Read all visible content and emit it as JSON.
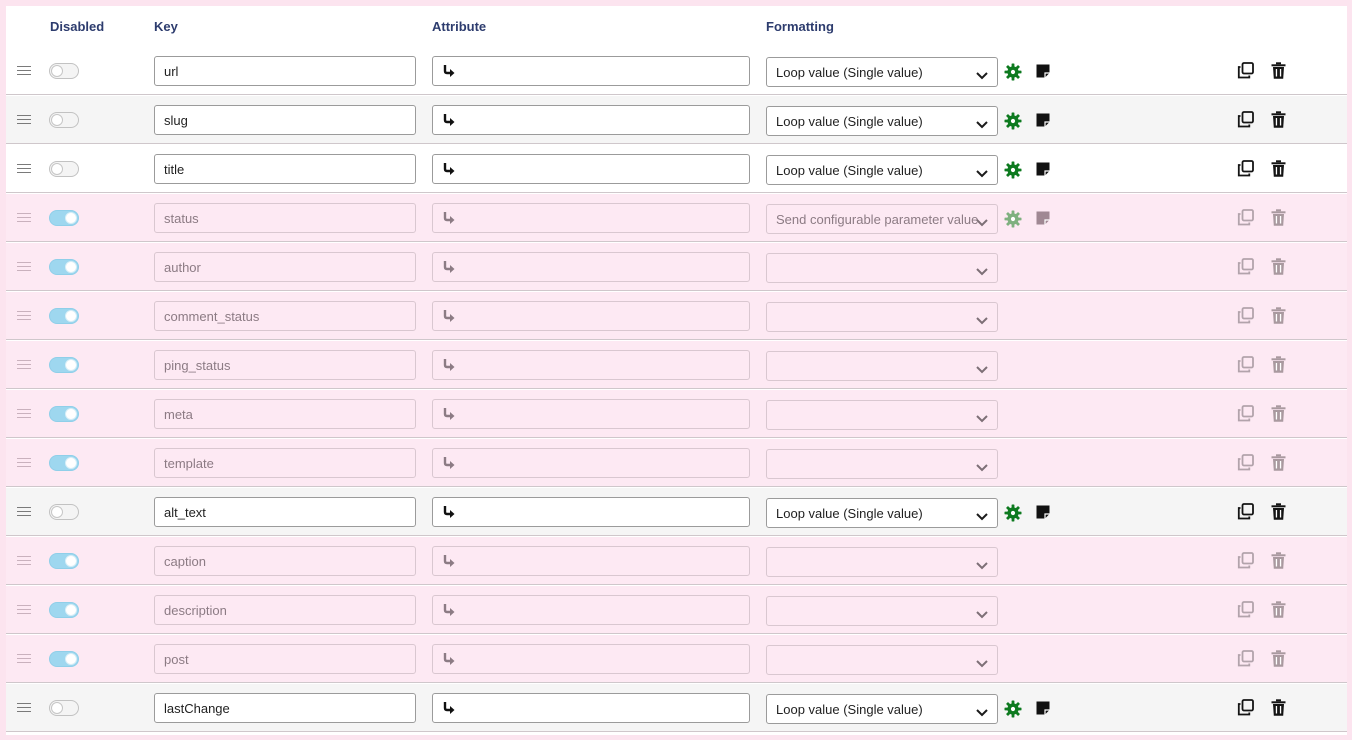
{
  "header": {
    "disabled": "Disabled",
    "key": "Key",
    "attribute": "Attribute",
    "formatting": "Formatting"
  },
  "icons": {
    "drag": "drag-handle-icon",
    "attribute": "return-arrow-icon",
    "dropdown": "chevron-down-icon",
    "settings": "gear-icon",
    "note": "note-icon",
    "copy": "copy-icon",
    "delete": "trash-icon"
  },
  "colors": {
    "gear_green": "#0d7a1f",
    "toggle_on": "#9ed7ef",
    "disabled_row_bg": "#fde9f3"
  },
  "rows": [
    {
      "key": "url",
      "formatting": "Loop value (Single value)",
      "disabled": false,
      "show_tools": true
    },
    {
      "key": "slug",
      "formatting": "Loop value (Single value)",
      "disabled": false,
      "show_tools": true
    },
    {
      "key": "title",
      "formatting": "Loop value (Single value)",
      "disabled": false,
      "show_tools": true
    },
    {
      "key": "status",
      "formatting": "Send configurable parameter value",
      "disabled": true,
      "show_tools": true
    },
    {
      "key": "author",
      "formatting": "",
      "disabled": true,
      "show_tools": false
    },
    {
      "key": "comment_status",
      "formatting": "",
      "disabled": true,
      "show_tools": false
    },
    {
      "key": "ping_status",
      "formatting": "",
      "disabled": true,
      "show_tools": false
    },
    {
      "key": "meta",
      "formatting": "",
      "disabled": true,
      "show_tools": false
    },
    {
      "key": "template",
      "formatting": "",
      "disabled": true,
      "show_tools": false
    },
    {
      "key": "alt_text",
      "formatting": "Loop value (Single value)",
      "disabled": false,
      "show_tools": true
    },
    {
      "key": "caption",
      "formatting": "",
      "disabled": true,
      "show_tools": false
    },
    {
      "key": "description",
      "formatting": "",
      "disabled": true,
      "show_tools": false
    },
    {
      "key": "post",
      "formatting": "",
      "disabled": true,
      "show_tools": false
    },
    {
      "key": "lastChange",
      "formatting": "Loop value (Single value)",
      "disabled": false,
      "show_tools": true
    }
  ]
}
